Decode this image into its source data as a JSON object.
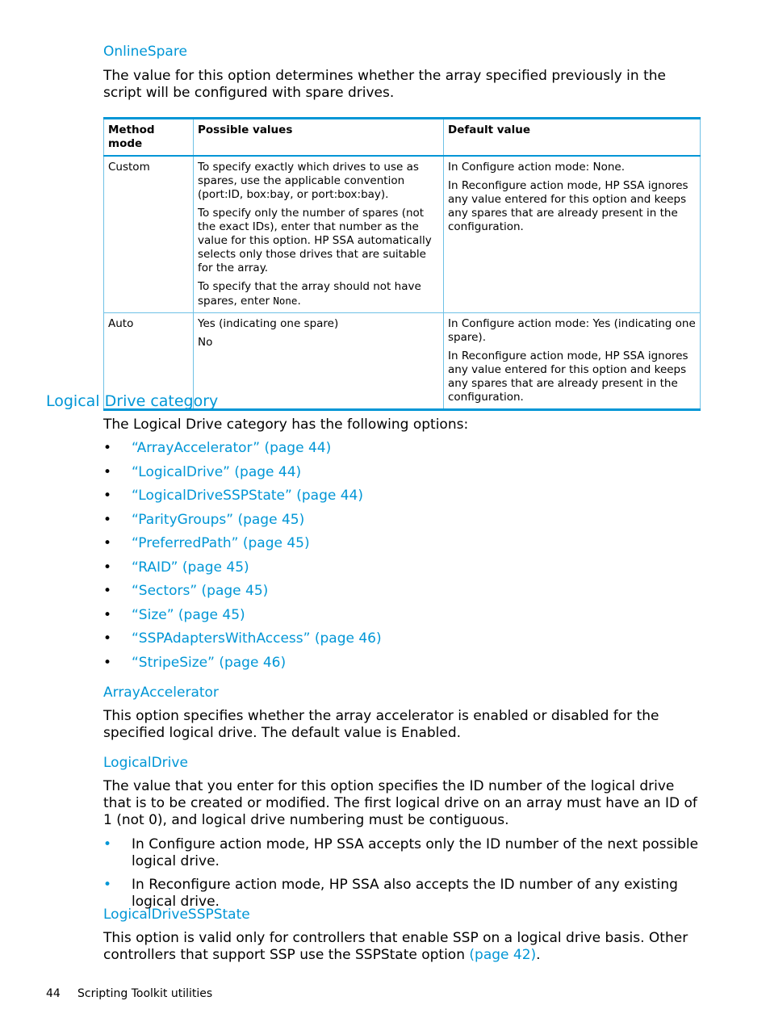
{
  "online_spare": {
    "heading": "OnlineSpare",
    "description": "The value for this option determines whether the array specified previously in the script will be configured with spare drives.",
    "table": {
      "headers": [
        "Method mode",
        "Possible values",
        "Default value"
      ],
      "rows": [
        {
          "mode": "Custom",
          "possible": [
            "To specify exactly which drives to use as spares, use the applicable convention (port:ID, box:bay, or port:box:bay).",
            "To specify only the number of spares (not the exact IDs), enter that number as the value for this option. HP SSA automatically selects only those drives that are suitable for the array.",
            "To specify that the array should not have spares, enter "
          ],
          "possible_code": "None",
          "possible_tail": ".",
          "default": [
            "In Configure action mode: None.",
            "In Reconfigure action mode, HP SSA ignores any value entered for this option and keeps any spares that are already present in the configuration."
          ]
        },
        {
          "mode": "Auto",
          "possible": [
            "Yes (indicating one spare)",
            "No"
          ],
          "default": [
            "In Configure action mode: Yes (indicating one spare).",
            "In Reconfigure action mode, HP SSA ignores any value entered for this option and keeps any spares that are already present in the configuration."
          ]
        }
      ]
    }
  },
  "logical_drive_category": {
    "heading": "Logical Drive category",
    "intro": "The Logical Drive category has the following options:",
    "bullet": "•",
    "links": [
      "“ArrayAccelerator” (page 44)",
      "“LogicalDrive” (page 44)",
      "“LogicalDriveSSPState” (page 44)",
      "“ParityGroups” (page 45)",
      "“PreferredPath” (page 45)",
      "“RAID” (page 45)",
      "“Sectors” (page 45)",
      "“Size” (page 45)",
      "“SSPAdaptersWithAccess” (page 46)",
      "“StripeSize” (page 46)"
    ]
  },
  "array_accelerator": {
    "heading": "ArrayAccelerator",
    "description": "This option specifies whether the array accelerator is enabled or disabled for the specified logical drive. The default value is Enabled."
  },
  "logical_drive": {
    "heading": "LogicalDrive",
    "description": "The value that you enter for this option specifies the ID number of the logical drive that is to be created or modified. The first logical drive on an array must have an ID of 1 (not 0), and logical drive numbering must be contiguous.",
    "bullets": [
      "In Configure action mode, HP SSA accepts only the ID number of the next possible logical drive.",
      "In Reconfigure action mode, HP SSA also accepts the ID number of any existing logical drive."
    ]
  },
  "logical_drive_ssp_state": {
    "heading": "LogicalDriveSSPState",
    "description": "This option is valid only for controllers that enable SSP on a logical drive basis. Other controllers that support SSP use the SSPState option ",
    "link": "(page 42)",
    "tail": "."
  },
  "footer": {
    "page_number": "44",
    "section": "Scripting Toolkit utilities"
  }
}
